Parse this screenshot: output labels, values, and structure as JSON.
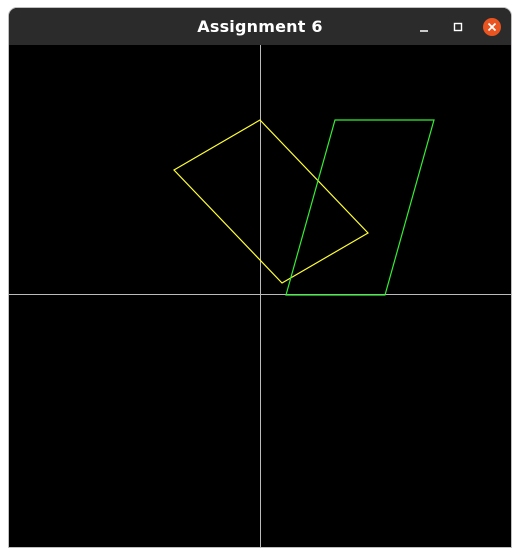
{
  "window": {
    "title": "Assignment 6",
    "controls": {
      "minimize": "minimize",
      "maximize": "maximize",
      "close": "close"
    },
    "colors": {
      "titlebar": "#2b2b2b",
      "close_button": "#e95420"
    }
  },
  "canvas": {
    "background": "#000000",
    "axes_color": "#bbbbbb",
    "shapes": [
      {
        "name": "yellow-quadrilateral",
        "color": "#ffff33"
      },
      {
        "name": "green-parallelogram",
        "color": "#33ee33"
      }
    ]
  }
}
